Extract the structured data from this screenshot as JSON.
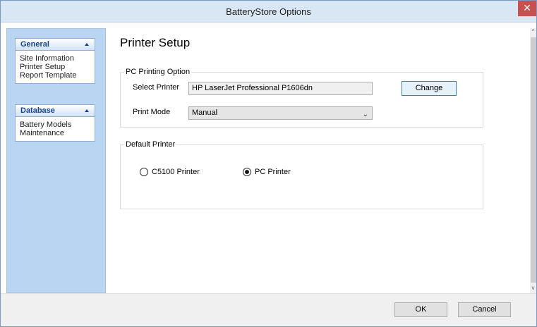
{
  "window": {
    "title": "BatteryStore Options",
    "close_symbol": "✕"
  },
  "sidebar": {
    "groups": [
      {
        "header": "General",
        "items": [
          "Site Information",
          "Printer Setup",
          "Report Template"
        ]
      },
      {
        "header": "Database",
        "items": [
          "Battery Models",
          "Maintenance"
        ]
      }
    ]
  },
  "page": {
    "title": "Printer Setup",
    "pc_printing": {
      "legend": "PC Printing Option",
      "select_printer_label": "Select Printer",
      "printer_value": "HP LaserJet Professional P1606dn",
      "change_label": "Change",
      "print_mode_label": "Print Mode",
      "print_mode_value": "Manual"
    },
    "default_printer": {
      "legend": "Default Printer",
      "options": [
        {
          "label": "C5100  Printer",
          "selected": false
        },
        {
          "label": "PC Printer",
          "selected": true
        }
      ]
    }
  },
  "footer": {
    "ok_label": "OK",
    "cancel_label": "Cancel"
  },
  "icons": {
    "chevron_down": "⌄",
    "scroll_up": "^",
    "scroll_down": "v"
  }
}
